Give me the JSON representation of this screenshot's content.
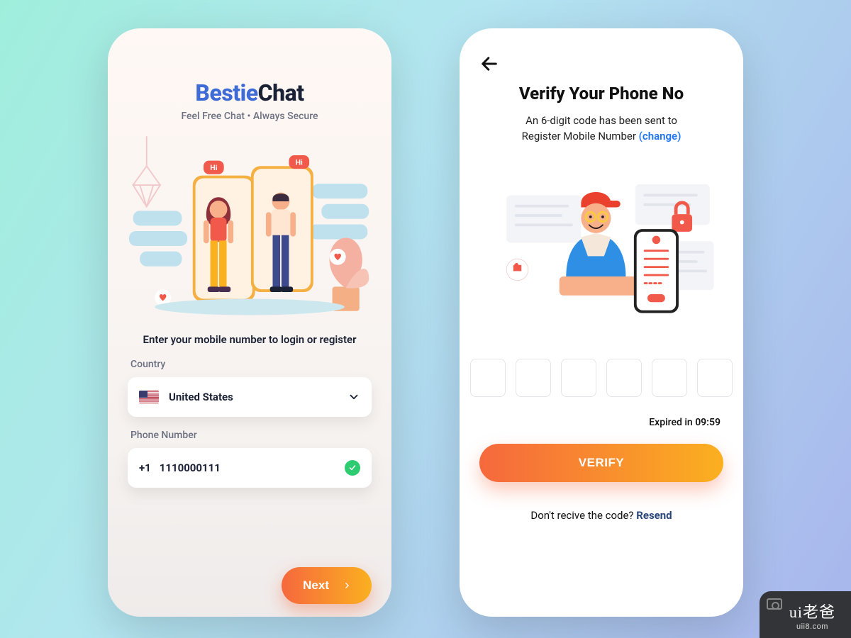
{
  "login": {
    "brand": {
      "part1": "Bestie",
      "part2": "Chat"
    },
    "tagline": "Feel Free Chat • Always Secure",
    "illustration": {
      "bubble_hi": "Hi"
    },
    "prompt": "Enter your mobile number to login or register",
    "country_label": "Country",
    "country_value": "United States",
    "phone_label": "Phone Number",
    "dial_code": "+1",
    "phone_value": "1110000111",
    "next_label": "Next"
  },
  "verify": {
    "title": "Verify Your Phone No",
    "subtitle_line1": "An 6-digit code has been sent to",
    "subtitle_line2_prefix": "Register Mobile Number ",
    "change_label": "(change)",
    "otp_count": 6,
    "expiry_prefix": "Expired in ",
    "expiry_time": "09:59",
    "verify_label": "VERIFY",
    "resend_prefix": "Don't recive the code? ",
    "resend_label": "Resend"
  },
  "watermark": {
    "brand": "ui老爸",
    "url": "uii8.com"
  }
}
